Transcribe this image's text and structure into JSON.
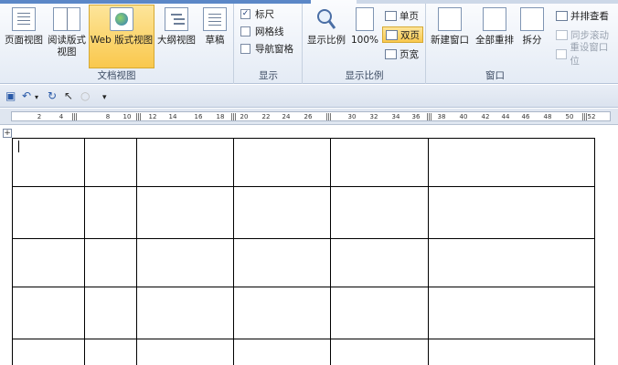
{
  "ribbon": {
    "views": {
      "group_label": "文档视图",
      "buttons": [
        {
          "label": "页面视图",
          "icon": "page-view-icon"
        },
        {
          "label": "阅读版式\n视图",
          "icon": "reading-view-icon"
        },
        {
          "label": "Web 版式视图",
          "icon": "web-view-icon",
          "active": true
        },
        {
          "label": "大纲视图",
          "icon": "outline-view-icon"
        },
        {
          "label": "草稿",
          "icon": "draft-view-icon"
        }
      ]
    },
    "show": {
      "group_label": "显示",
      "items": [
        {
          "label": "标尺",
          "checked": true
        },
        {
          "label": "网格线",
          "checked": false
        },
        {
          "label": "导航窗格",
          "checked": false
        }
      ]
    },
    "zoom": {
      "group_label": "显示比例",
      "zoom_label": "显示比例",
      "hundred_label": "100%",
      "one_page": "单页",
      "two_pages": "双页",
      "page_width": "页宽"
    },
    "window": {
      "group_label": "窗口",
      "new_window": "新建窗口",
      "arrange_all": "全部重排",
      "split": "拆分",
      "side_by_side": "并排查看",
      "sync_scroll": "同步滚动",
      "reset_position": "重设窗口位"
    }
  },
  "ruler": {
    "ticks": [
      "2",
      "4",
      "8",
      "10",
      "12",
      "14",
      "16",
      "18",
      "20",
      "22",
      "24",
      "26",
      "30",
      "32",
      "34",
      "36",
      "38",
      "40",
      "42",
      "44",
      "46",
      "48",
      "50",
      "52"
    ]
  },
  "table": {
    "rows": 5,
    "cols": 6
  }
}
